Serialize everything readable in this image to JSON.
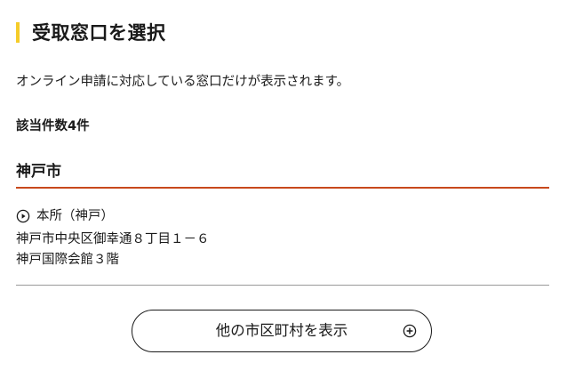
{
  "heading": {
    "title": "受取窓口を選択"
  },
  "description": "オンライン申請に対応している窓口だけが表示されます。",
  "result_count": "該当件数4件",
  "city": {
    "name": "神戸市"
  },
  "office": {
    "name": "本所（神戸）",
    "address": "神戸市中央区御幸通８丁目１－６",
    "building": "神戸国際会館３階"
  },
  "more_button": {
    "label": "他の市区町村を表示"
  },
  "colors": {
    "accent_bar": "#f5cc2a",
    "city_rule": "#c8491c",
    "divider": "#9a9a9a",
    "text": "#1a1a1a"
  },
  "icons": {
    "office": "play-circle-icon",
    "more": "plus-circle-icon"
  }
}
